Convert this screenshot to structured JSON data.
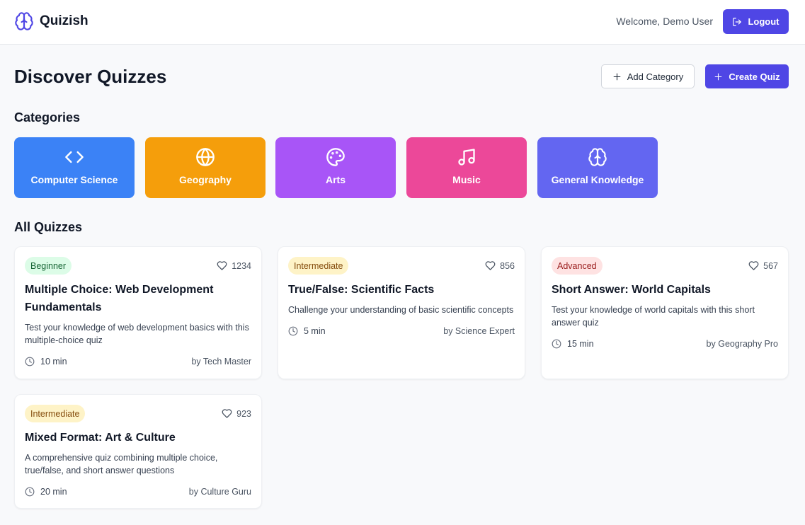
{
  "app": {
    "name": "Quizish",
    "welcome": "Welcome, Demo User",
    "logout_label": "Logout",
    "accent": "#4f46e5"
  },
  "page": {
    "title": "Discover Quizzes",
    "add_category_label": "Add Category",
    "create_quiz_label": "Create Quiz"
  },
  "categories_section": {
    "title": "Categories"
  },
  "categories": [
    {
      "label": "Computer Science",
      "icon": "code-icon",
      "color": "#3b82f6"
    },
    {
      "label": "Geography",
      "icon": "globe-icon",
      "color": "#f59e0b"
    },
    {
      "label": "Arts",
      "icon": "palette-icon",
      "color": "#a855f7"
    },
    {
      "label": "Music",
      "icon": "music-icon",
      "color": "#ec4899"
    },
    {
      "label": "General Knowledge",
      "icon": "brain-icon",
      "color": "#6366f1"
    }
  ],
  "quizzes_section": {
    "title": "All Quizzes"
  },
  "quizzes": [
    {
      "level": "Beginner",
      "likes": "1234",
      "title": "Multiple Choice: Web Development Fundamentals",
      "description": "Test your knowledge of web development basics with this multiple-choice quiz",
      "duration": "10 min",
      "author": "by Tech Master"
    },
    {
      "level": "Intermediate",
      "likes": "856",
      "title": "True/False: Scientific Facts",
      "description": "Challenge your understanding of basic scientific concepts",
      "duration": "5 min",
      "author": "by Science Expert"
    },
    {
      "level": "Advanced",
      "likes": "567",
      "title": "Short Answer: World Capitals",
      "description": "Test your knowledge of world capitals with this short answer quiz",
      "duration": "15 min",
      "author": "by Geography Pro"
    },
    {
      "level": "Intermediate",
      "likes": "923",
      "title": "Mixed Format: Art & Culture",
      "description": "A comprehensive quiz combining multiple choice, true/false, and short answer questions",
      "duration": "20 min",
      "author": "by Culture Guru"
    }
  ]
}
